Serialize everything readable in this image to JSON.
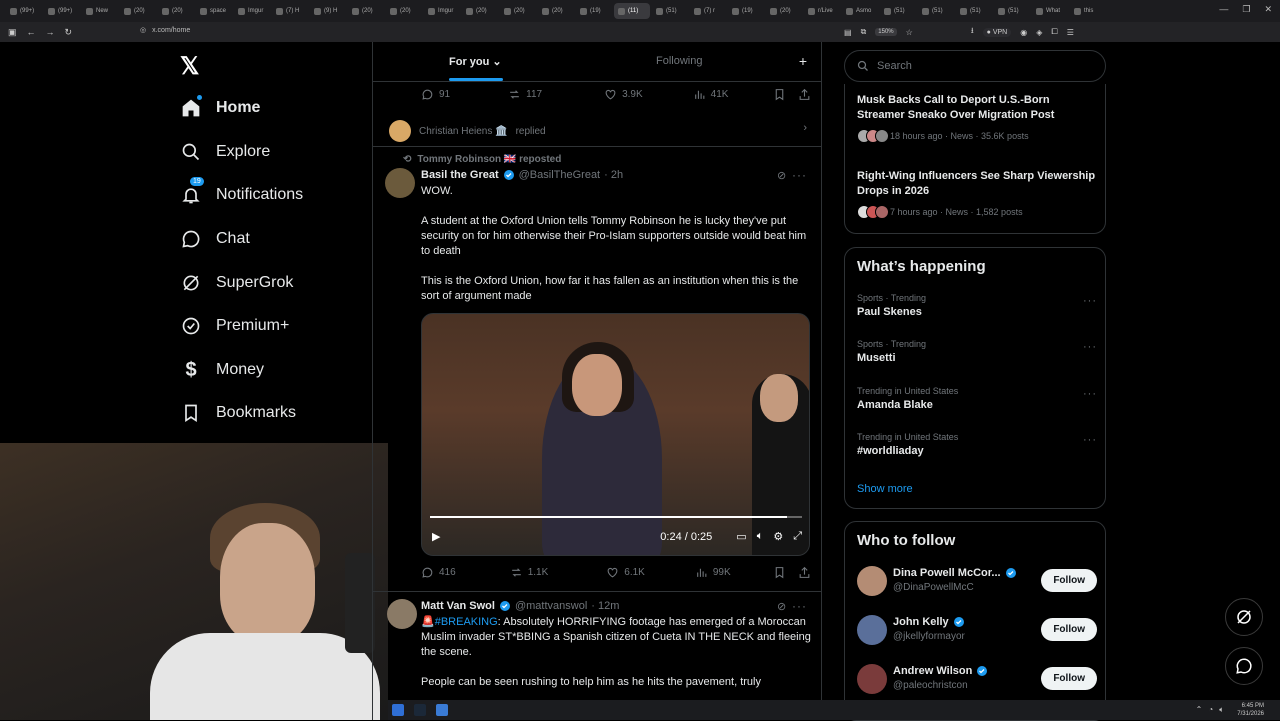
{
  "browser": {
    "tabs": [
      "(99+)",
      "(99+)",
      "New",
      "(20)",
      "(20)",
      "space",
      "Imgur",
      "(7) H",
      "(9) H",
      "(20)",
      "(20)",
      "Imgur",
      "(20)",
      "(20)",
      "(20)",
      "(19)",
      "(11)",
      "(51)",
      "(7) r",
      "(19)",
      "(20)",
      "r/Live",
      "Asmo",
      "(51)",
      "(51)",
      "(51)",
      "(51)",
      "What",
      "this"
    ],
    "active_tab_index": 16,
    "url": "x.com/home",
    "zoom": "150%",
    "vpn_label": "VPN"
  },
  "leftnav": {
    "items": [
      {
        "label": "Home",
        "icon": "home-icon"
      },
      {
        "label": "Explore",
        "icon": "search-icon"
      },
      {
        "label": "Notifications",
        "icon": "bell-icon",
        "badge": "19"
      },
      {
        "label": "Chat",
        "icon": "chat-icon"
      },
      {
        "label": "SuperGrok",
        "icon": "grok-icon"
      },
      {
        "label": "Premium+",
        "icon": "verified-icon"
      },
      {
        "label": "Money",
        "icon": "dollar-icon"
      },
      {
        "label": "Bookmarks",
        "icon": "bookmark-icon"
      }
    ]
  },
  "feed": {
    "tabs": {
      "for_you": "For you",
      "following": "Following"
    },
    "prev_post_stats": {
      "replies": "91",
      "reposts": "117",
      "likes": "3.9K",
      "views": "41K"
    },
    "replied_line": {
      "name": "Christian Heiens 🏛️",
      "text": "replied"
    },
    "post1": {
      "repost_by": "Tommy Robinson 🇬🇧 reposted",
      "name": "Basil the Great",
      "handle": "@BasilTheGreat",
      "time": "· 2h",
      "paragraphs": [
        "WOW.",
        "A student at the Oxford Union tells Tommy Robinson he is lucky they've put security on for him otherwise their Pro-Islam supporters outside would beat him to death",
        "This is the Oxford Union, how far it has fallen as an institution when this is the sort of argument made"
      ],
      "video_time": "0:24 / 0:25",
      "video_progress": 0.96,
      "stats": {
        "replies": "416",
        "reposts": "1.1K",
        "likes": "6.1K",
        "views": "99K"
      }
    },
    "post2": {
      "name": "Matt Van Swol",
      "handle": "@mattvanswol",
      "time": "· 12m",
      "hashtag": "#BREAKING",
      "text_after_hashtag": ": Absolutely HORRIFYING footage has emerged of a Moroccan Muslim invader ST*BBING a Spanish citizen of Cueta IN THE NECK and fleeing the scene.",
      "paragraph2": "People can be seen rushing to help him as he hits the pavement, truly"
    }
  },
  "right": {
    "search_placeholder": "Search",
    "news": [
      {
        "title": "Musk Backs Call to Deport U.S.-Born Streamer Sneako Over Migration Post",
        "meta": "18 hours ago · News · 35.6K posts"
      },
      {
        "title": "Right-Wing Influencers See Sharp Viewership Drops in 2026",
        "meta": "7 hours ago · News · 1,582 posts"
      }
    ],
    "happening": {
      "title": "What’s happening",
      "trends": [
        {
          "category": "Sports · Trending",
          "name": "Paul Skenes"
        },
        {
          "category": "Sports · Trending",
          "name": "Musetti"
        },
        {
          "category": "Trending in United States",
          "name": "Amanda Blake"
        },
        {
          "category": "Trending in United States",
          "name": "#worldliaday"
        }
      ],
      "show_more": "Show more"
    },
    "who_to_follow": {
      "title": "Who to follow",
      "people": [
        {
          "name": "Dina Powell McCor...",
          "handle": "@DinaPowellMcC",
          "button": "Follow"
        },
        {
          "name": "John Kelly",
          "handle": "@jkellyformayor",
          "button": "Follow"
        },
        {
          "name": "Andrew Wilson",
          "handle": "@paleochristcon",
          "button": "Follow"
        }
      ]
    }
  },
  "taskbar": {
    "time": "6:45 PM",
    "date": "7/31/2026"
  },
  "colors": {
    "accent": "#1d9bf0",
    "background": "#000000",
    "border": "#2f3336",
    "muted": "#71767b"
  }
}
